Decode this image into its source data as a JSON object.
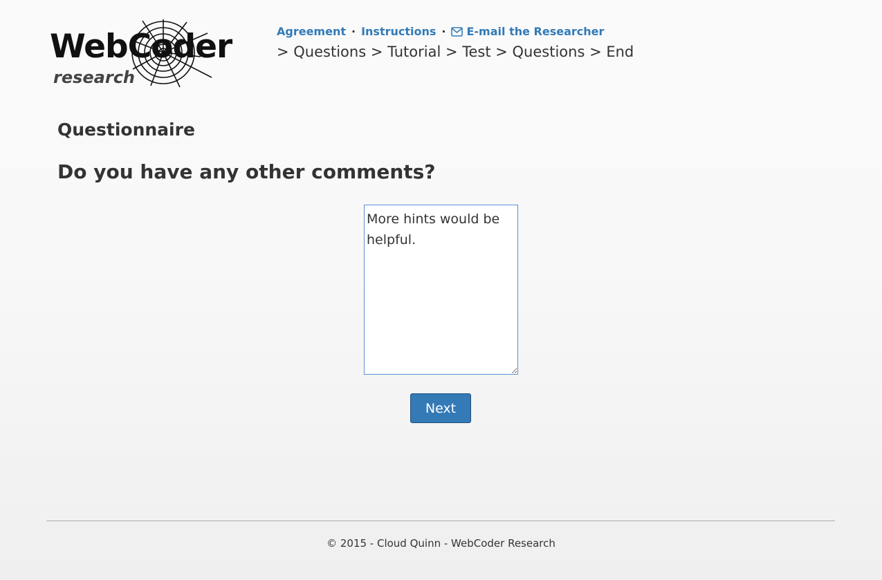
{
  "logo": {
    "wordmark": "WebCoder",
    "subtitle": "research"
  },
  "nav": {
    "links": [
      {
        "label": "Agreement"
      },
      {
        "label": "Instructions"
      },
      {
        "label": "E-mail the Researcher",
        "icon": "envelope-icon"
      }
    ],
    "separator": "·",
    "steps": "> Questions > Tutorial > Test > Questions > End"
  },
  "page": {
    "section_title": "Questionnaire",
    "question": "Do you have any other comments?",
    "comment": {
      "value": "More hints would be helpful.",
      "placeholder": ""
    },
    "next_label": "Next"
  },
  "footer": {
    "text": "© 2015 - Cloud Quinn - WebCoder Research"
  },
  "colors": {
    "link": "#337ab7",
    "button": "#337ab7",
    "text": "#333333"
  }
}
